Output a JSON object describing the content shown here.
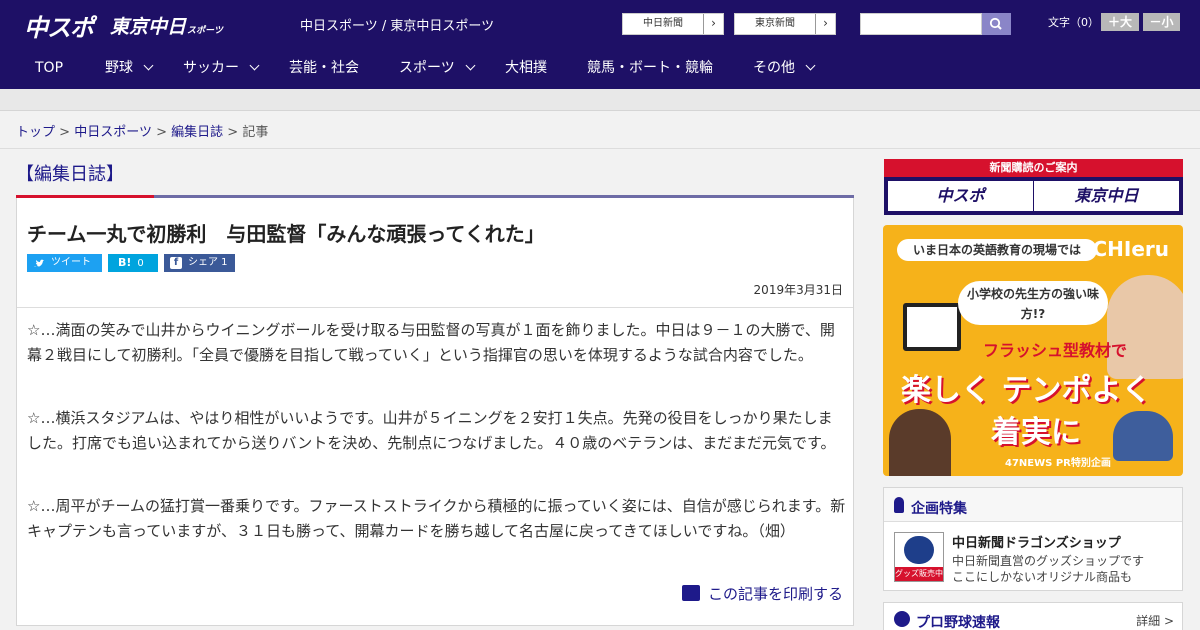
{
  "header": {
    "logo_chuspo": "中スポ",
    "logo_tokyo": "東京中日",
    "logo_tokyo_suffix": "スポーツ",
    "site_names": "中日スポーツ / 東京中日スポーツ",
    "links": [
      {
        "label": "中日新聞"
      },
      {
        "label": "東京新聞"
      }
    ],
    "search_placeholder": "",
    "font_size_label": "文字（0）",
    "font_larger": "＋大",
    "font_smaller": "－小"
  },
  "nav": [
    {
      "label": "TOP"
    },
    {
      "label": "野球"
    },
    {
      "label": "サッカー"
    },
    {
      "label": "芸能・社会"
    },
    {
      "label": "スポーツ"
    },
    {
      "label": "大相撲"
    },
    {
      "label": "競馬・ボート・競輪"
    },
    {
      "label": "その他"
    }
  ],
  "breadcrumb": {
    "items": [
      "トップ",
      "中日スポーツ",
      "編集日誌"
    ],
    "current": "記事",
    "separator": ">"
  },
  "section_title": "【編集日誌】",
  "article": {
    "headline": "チーム一丸で初勝利　与田監督「みんな頑張ってくれた」",
    "share": {
      "tweet": "ツイート",
      "hatena_icon": "B!",
      "hatena_count": "0",
      "facebook_icon": "f",
      "facebook": "シェア 1"
    },
    "date": "2019年3月31日",
    "paragraphs": [
      "☆…満面の笑みで山井からウイニングボールを受け取る与田監督の写真が１面を飾りました。中日は９－１の大勝で、開幕２戦目にして初勝利。「全員で優勝を目指して戦っていく」という指揮官の思いを体現するような試合内容でした。",
      "☆…横浜スタジアムは、やはり相性がいいようです。山井が５イニングを２安打１失点。先発の役目をしっかり果たしました。打席でも追い込まれてから送りバントを決め、先制点につなげました。４０歳のベテランは、まだまだ元気です。",
      "☆…周平がチームの猛打賞一番乗りです。ファーストストライクから積極的に振っていく姿には、自信が感じられます。新キャプテンも言っていますが、３１日も勝って、開幕カードを勝ち越して名古屋に戻ってきてほしいですね。（畑）"
    ],
    "print_label": "この記事を印刷する"
  },
  "sidebar": {
    "subscription": {
      "heading": "新聞購読のご案内",
      "left": "中スポ",
      "right": "東京中日"
    },
    "ad": {
      "pill": "いま日本の英語教育の現場では",
      "brand": "CHIeru",
      "bubble": "小学校の先生方の強い味方!?",
      "flash": "フラッシュ型教材で",
      "big_line1": "楽しく テンポよく",
      "big_line2": "着実に",
      "credit": "47NEWS PR特別企画"
    },
    "feature": {
      "heading": "企画特集",
      "thumb_label": "グッズ販売中",
      "name": "中日新聞ドラゴンズショップ",
      "desc1": "中日新聞直営のグッズショップです",
      "desc2": "ここにしかないオリジナル商品も"
    },
    "baseball": {
      "heading": "プロ野球速報",
      "more": "詳細 >"
    }
  },
  "colors": {
    "brand_navy": "#1e1066",
    "accent_red": "#d6112d",
    "link_blue": "#1e1a8a",
    "ad_orange": "#f6b21a",
    "twitter": "#1da1f2",
    "hatena": "#00a4de",
    "facebook": "#3b5998"
  }
}
